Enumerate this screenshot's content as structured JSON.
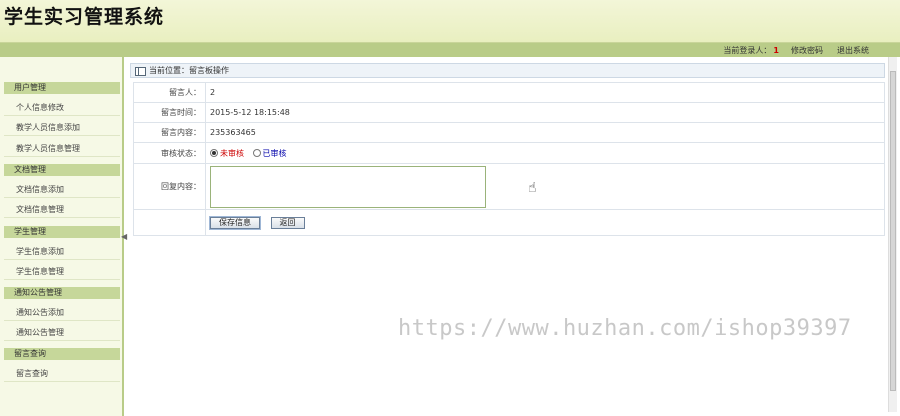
{
  "app": {
    "title": "学生实习管理系统"
  },
  "topbar": {
    "login_label": "当前登录人：",
    "login_user": "1",
    "change_password": "修改密码",
    "logout": "退出系统"
  },
  "sidebar": {
    "groups": [
      {
        "label": "用户管理",
        "items": [
          "个人信息修改",
          "教学人员信息添加",
          "教学人员信息管理"
        ]
      },
      {
        "label": "文档管理",
        "items": [
          "文档信息添加",
          "文档信息管理"
        ]
      },
      {
        "label": "学生管理",
        "items": [
          "学生信息添加",
          "学生信息管理"
        ]
      },
      {
        "label": "通知公告管理",
        "items": [
          "通知公告添加",
          "通知公告管理"
        ]
      },
      {
        "label": "留言查询",
        "items": [
          "留言查询"
        ]
      }
    ]
  },
  "breadcrumb": {
    "text": "当前位置：留言板操作"
  },
  "form": {
    "author_label": "留言人：",
    "author_value": "2",
    "time_label": "留言时间：",
    "time_value": "2015-5-12 18:15:48",
    "content_label": "留言内容：",
    "content_value": "235363465",
    "status_label": "审核状态：",
    "status_unreviewed": "未审核",
    "status_reviewed": "已审核",
    "reply_label": "回复内容：",
    "reply_value": "",
    "save_button": "保存信息",
    "back_button": "返回"
  },
  "watermark": "https://www.huzhan.com/ishop39397",
  "icons": {
    "breadcrumb": "window-icon",
    "cursor": "hand-pointer-icon",
    "collapse": "chevron-left-icon"
  },
  "colors": {
    "header_bg": "#eef2cc",
    "topbar_bg": "#b9cc88",
    "sidebar_group_bg": "#c6d79a",
    "accent_red": "#cc0000"
  }
}
